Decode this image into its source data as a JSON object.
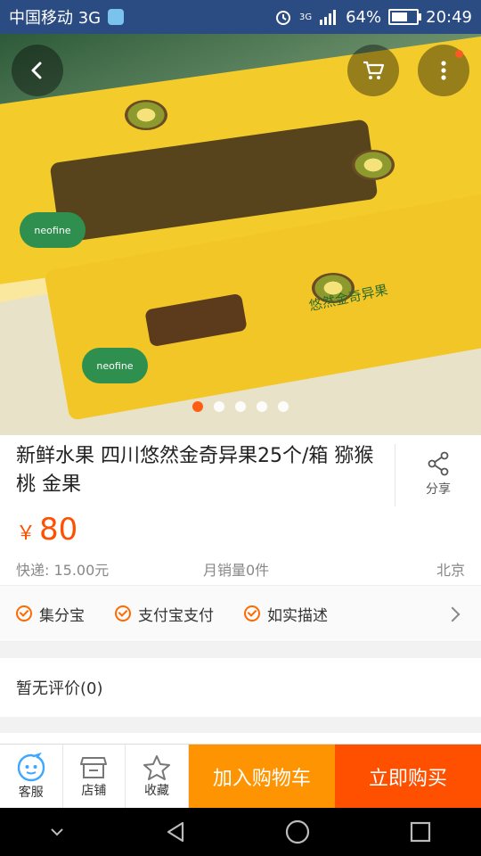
{
  "status_bar": {
    "carrier": "中国移动 3G",
    "signal_label": "3G",
    "battery": "64%",
    "battery_level": 0.64,
    "time": "20:49"
  },
  "hero": {
    "image_count": 5,
    "active_index": 0,
    "logo_text": "neofine",
    "brand_text": "悠然金奇异果"
  },
  "product": {
    "title": "新鲜水果 四川悠然金奇异果25个/箱 猕猴桃 金果",
    "share_label": "分享",
    "currency": "￥",
    "price": "80",
    "shipping": "快递: 15.00元",
    "monthly_sales": "月销量0件",
    "location": "北京"
  },
  "services": [
    "集分宝",
    "支付宝支付",
    "如实描述"
  ],
  "reviews": {
    "label": "暂无评价(0)"
  },
  "action_bar": {
    "service_label": "客服",
    "shop_label": "店铺",
    "favorite_label": "收藏",
    "add_cart_label": "加入购物车",
    "buy_now_label": "立即购买"
  },
  "colors": {
    "status_bar": "#2b4c82",
    "price": "#ff5000",
    "add_cart": "#ff9402",
    "buy_now": "#ff5000",
    "service_icon": "#3fa7ff"
  },
  "icons": [
    "back-icon",
    "cart-icon",
    "more-icon",
    "share-icon",
    "service-icon",
    "shop-icon",
    "star-icon",
    "check-icon"
  ]
}
